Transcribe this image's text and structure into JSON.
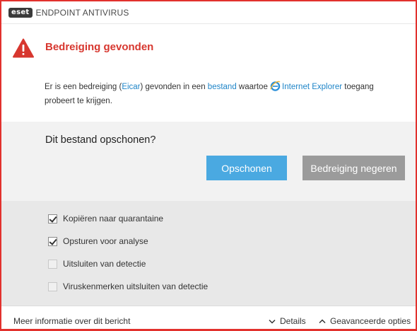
{
  "titlebar": {
    "logo_text": "eset",
    "app_title": "ENDPOINT ANTIVIRUS"
  },
  "alert": {
    "icon": "warning-triangle-icon",
    "title": "Bedreiging gevonden",
    "text_part1": "Er is een bedreiging (",
    "threat_name": "Eicar",
    "text_part2": ") gevonden in een ",
    "file_link": "bestand",
    "text_part3": " waartoe ",
    "app_icon": "internet-explorer-icon",
    "app_name": "Internet Explorer",
    "text_part4": " toegang",
    "text_line2": "probeert te krijgen."
  },
  "question": {
    "text": "Dit bestand opschonen?",
    "clean_button": "Opschonen",
    "ignore_button": "Bedreiging negeren"
  },
  "options": [
    {
      "label": "Kopiëren naar quarantaine",
      "checked": true
    },
    {
      "label": "Opsturen voor analyse",
      "checked": true
    },
    {
      "label": "Uitsluiten van detectie",
      "checked": false
    },
    {
      "label": "Viruskenmerken uitsluiten van detectie",
      "checked": false
    }
  ],
  "footer": {
    "more_info": "Meer informatie over dit bericht",
    "details": "Details",
    "advanced": "Geavanceerde opties"
  },
  "colors": {
    "accent_red": "#d7372f",
    "window_border": "#e2312d",
    "link_blue": "#1f85c8",
    "primary_button": "#4aa9e1",
    "secondary_button": "#9b9b9b"
  }
}
